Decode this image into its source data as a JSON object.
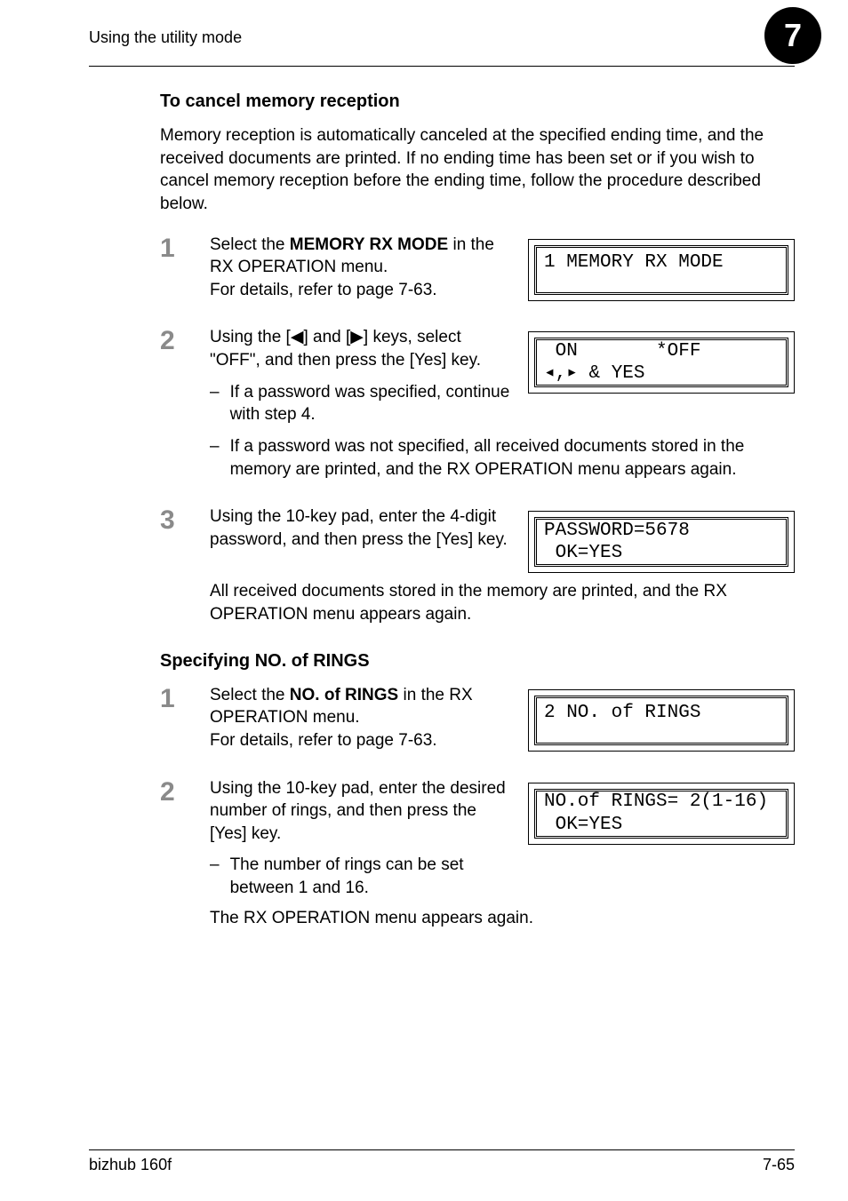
{
  "header": {
    "running_title": "Using the utility mode",
    "chapter_number": "7"
  },
  "section1": {
    "heading": "To cancel memory reception",
    "intro": "Memory reception is automatically canceled at the specified ending time, and the received documents are printed. If no ending time has been set or if you wish to cancel memory reception before the ending time, follow the procedure described below.",
    "step1": {
      "num": "1",
      "part_a": "Select the ",
      "bold": "MEMORY RX MODE",
      "part_b": " in the RX OPERATION menu.",
      "line2": "For details, refer to page 7-63.",
      "lcd": "1 MEMORY RX MODE\n "
    },
    "step2": {
      "num": "2",
      "text_a": "Using the [",
      "left": "◀",
      "mid": "] and [",
      "right": "▶",
      "text_b": "] keys, select \"OFF\", and then press the [Yes] key.",
      "lcd": " ON       *OFF\n◂,▸ & YES",
      "sub1": "If a password was specified, continue with step 4.",
      "sub2": "If a password was not specified, all received documents stored in the memory are printed, and the RX OPERATION menu appears again."
    },
    "step3": {
      "num": "3",
      "text": "Using the 10-key pad, enter the 4-digit password, and then press the [Yes] key.",
      "lcd": "PASSWORD=5678\n OK=YES",
      "after": "All received documents stored in the memory are printed, and the RX OPERATION menu appears again."
    }
  },
  "section2": {
    "heading": "Specifying NO. of RINGS",
    "step1": {
      "num": "1",
      "part_a": "Select the ",
      "bold": "NO. of RINGS",
      "part_b": " in the RX OPERATION menu.",
      "line2": "For details, refer to page 7-63.",
      "lcd": "2 NO. of RINGS\n "
    },
    "step2": {
      "num": "2",
      "text": "Using the 10-key pad, enter the desired number of rings, and then press the [Yes] key.",
      "lcd": "NO.of RINGS= 2(1-16)\n OK=YES",
      "sub1": "The number of rings can be set between 1 and 16.",
      "after": "The RX OPERATION menu appears again."
    }
  },
  "footer": {
    "product": "bizhub 160f",
    "page": "7-65"
  }
}
